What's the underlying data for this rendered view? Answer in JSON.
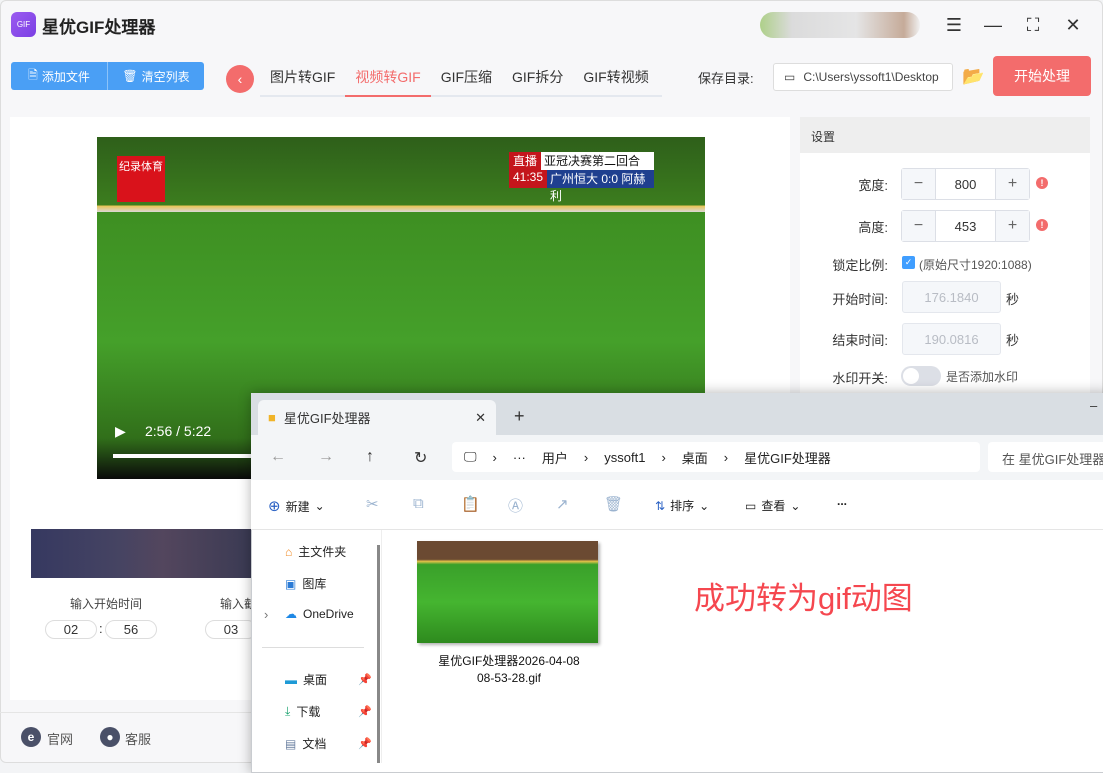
{
  "app": {
    "title": "星优GIF处理器",
    "logo_text": "GIF"
  },
  "toolbar": {
    "add_file": "添加文件",
    "clear_list": "清空列表",
    "save_dir_label": "保存目录:",
    "save_dir": "C:\\Users\\yssoft1\\Desktop",
    "start": "开始处理"
  },
  "tabs": [
    {
      "label": "图片转GIF"
    },
    {
      "label": "视频转GIF",
      "active": true
    },
    {
      "label": "GIF压缩"
    },
    {
      "label": "GIF拆分"
    },
    {
      "label": "GIF转视频"
    }
  ],
  "video": {
    "time": "2:56 / 5:22",
    "progress": 0.55,
    "overlay": {
      "logo": "纪录体育",
      "live": "直播",
      "match": "亚冠决赛第二回合",
      "clock": "41:35",
      "score": "广州恒大 0:0 阿赫利"
    }
  },
  "trim": {
    "start_label": "输入开始时间",
    "start_min": "02",
    "start_sec": "56",
    "end_label": "输入截",
    "end_min": "03",
    "separator": ":"
  },
  "footer": {
    "website": "官网",
    "support": "客服"
  },
  "settings": {
    "header": "设置",
    "width_label": "宽度:",
    "width": "800",
    "height_label": "高度:",
    "height": "453",
    "lock_label": "锁定比例:",
    "lock_checked": true,
    "lock_note": "(原始尺寸1920:1088)",
    "start_label": "开始时间:",
    "start": "176.1840",
    "end_label": "结束时间:",
    "end": "190.0816",
    "unit": "秒",
    "watermark_label": "水印开关:",
    "watermark_note": "是否添加水印",
    "watermark_on": false
  },
  "explorer": {
    "tab_title": "星优GIF处理器",
    "breadcrumb": [
      "用户",
      "yssoft1",
      "桌面",
      "星优GIF处理器"
    ],
    "search_placeholder": "在 星优GIF处理器",
    "commands": {
      "new": "新建",
      "sort": "排序",
      "view": "查看",
      "more": "..."
    },
    "sidebar": [
      {
        "label": "主文件夹",
        "icon": "home-icon"
      },
      {
        "label": "图库",
        "icon": "gallery-icon"
      },
      {
        "label": "OneDrive",
        "icon": "cloud-icon"
      },
      {
        "label": "桌面",
        "icon": "desktop-icon",
        "pinned": true
      },
      {
        "label": "下载",
        "icon": "download-icon",
        "pinned": true
      },
      {
        "label": "文档",
        "icon": "document-icon",
        "pinned": true
      }
    ],
    "file": {
      "name_line1": "星优GIF处理器2026-04-08",
      "name_line2": "08-53-28.gif"
    }
  },
  "annotation": "成功转为gif动图",
  "colors": {
    "accent": "#f36c6c",
    "primary": "#4a9ff5",
    "annotation": "#f5474f"
  }
}
